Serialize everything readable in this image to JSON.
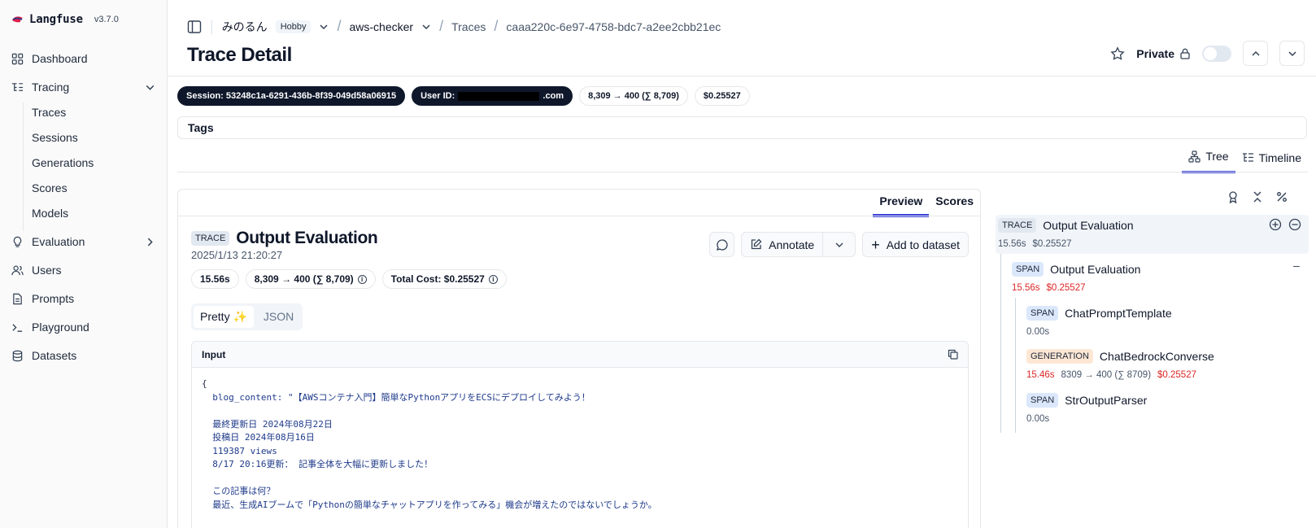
{
  "app": {
    "name": "Langfuse",
    "version": "v3.7.0"
  },
  "sidebar": {
    "items": [
      {
        "label": "Dashboard"
      },
      {
        "label": "Tracing"
      },
      {
        "label": "Evaluation"
      },
      {
        "label": "Users"
      },
      {
        "label": "Prompts"
      },
      {
        "label": "Playground"
      },
      {
        "label": "Datasets"
      }
    ],
    "tracing_sub": [
      "Traces",
      "Sessions",
      "Generations",
      "Scores",
      "Models"
    ]
  },
  "breadcrumb": {
    "org": "みのるん",
    "plan": "Hobby",
    "project": "aws-checker",
    "section": "Traces",
    "trace_id": "caaa220c-6e97-4758-bdc7-a2ee2cbb21ec"
  },
  "header": {
    "title": "Trace Detail",
    "private_label": "Private"
  },
  "pills": {
    "session": "Session: 53248c1a-6291-436b-8f39-049d58a06915",
    "user_prefix": "User ID:",
    "user_suffix": ".com",
    "tokens": "8,309 → 400 (∑ 8,709)",
    "cost": "$0.25527"
  },
  "tags_label": "Tags",
  "view_tabs": {
    "tree": "Tree",
    "timeline": "Timeline"
  },
  "panel": {
    "tabs": {
      "preview": "Preview",
      "scores": "Scores"
    },
    "badge": "TRACE",
    "title": "Output Evaluation",
    "timestamp": "2025/1/13 21:20:27",
    "latency": "15.56s",
    "tokens": "8,309 → 400 (∑ 8,709)",
    "total_cost": "Total Cost: $0.25527",
    "annotate": "Annotate",
    "add_to_dataset": "Add to dataset",
    "format": {
      "pretty": "Pretty ✨",
      "json": "JSON"
    },
    "input_label": "Input",
    "input_lines": [
      "{",
      "  blog_content: \"【AWSコンテナ入門】簡単なPythonアプリをECSにデプロイしてみよう！",
      "",
      "  最終更新日 2024年08月22日",
      "  投稿日 2024年08月16日",
      "  119387 views",
      "  8/17 20:16更新： 記事全体を大幅に更新しました！",
      "",
      "  この記事は何？",
      "  最近、生成AIブームで「Pythonの簡単なチャットアプリを作ってみる」機会が増えたのではないでしょうか。"
    ]
  },
  "tree": {
    "nodes": [
      {
        "badge": "TRACE",
        "name": "Output Evaluation",
        "latency": "15.56s",
        "cost": "$0.25527"
      },
      {
        "badge": "SPAN",
        "name": "Output Evaluation",
        "latency": "15.56s",
        "cost": "$0.25527"
      },
      {
        "badge": "SPAN",
        "name": "ChatPromptTemplate",
        "latency": "0.00s"
      },
      {
        "badge": "GENERATION",
        "name": "ChatBedrockConverse",
        "latency": "15.46s",
        "tokens": "8309 → 400 (∑ 8709)",
        "cost": "$0.25527"
      },
      {
        "badge": "SPAN",
        "name": "StrOutputParser",
        "latency": "0.00s"
      }
    ]
  },
  "colors": {
    "accent": "#3b43d6",
    "cost_red": "#dc2626",
    "pill_dark": "#0f172a"
  }
}
